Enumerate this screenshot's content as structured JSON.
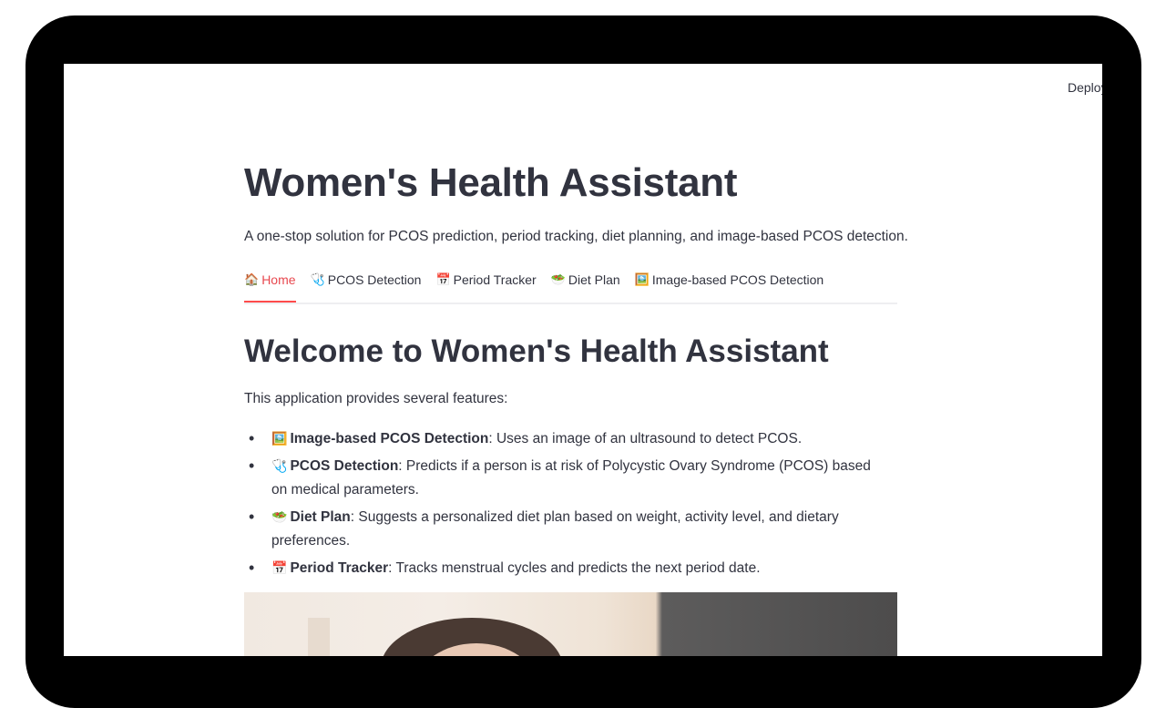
{
  "header": {
    "deploy_label": "Deploy"
  },
  "app": {
    "title": "Women's Health Assistant",
    "subtitle": "A one-stop solution for PCOS prediction, period tracking, diet planning, and image-based PCOS detection."
  },
  "tabs": [
    {
      "icon": "🏠",
      "icon_name": "house-icon",
      "label": "Home",
      "active": true
    },
    {
      "icon": "🩺",
      "icon_name": "stethoscope-icon",
      "label": "PCOS Detection",
      "active": false
    },
    {
      "icon": "📅",
      "icon_name": "calendar-icon",
      "label": "Period Tracker",
      "active": false
    },
    {
      "icon": "🥗",
      "icon_name": "salad-icon",
      "label": "Diet Plan",
      "active": false
    },
    {
      "icon": "🖼️",
      "icon_name": "picture-icon",
      "label": "Image-based PCOS Detection",
      "active": false
    }
  ],
  "home": {
    "heading": "Welcome to Women's Health Assistant",
    "intro": "This application provides several features:",
    "features": [
      {
        "icon": "🖼️",
        "icon_name": "picture-icon",
        "title": "Image-based PCOS Detection",
        "desc": ": Uses an image of an ultrasound to detect PCOS."
      },
      {
        "icon": "🩺",
        "icon_name": "stethoscope-icon",
        "title": "PCOS Detection",
        "desc": ": Predicts if a person is at risk of Polycystic Ovary Syndrome (PCOS) based on medical parameters."
      },
      {
        "icon": "🥗",
        "icon_name": "salad-icon",
        "title": "Diet Plan",
        "desc": ": Suggests a personalized diet plan based on weight, activity level, and dietary preferences."
      },
      {
        "icon": "📅",
        "icon_name": "calendar-icon",
        "title": "Period Tracker",
        "desc": ": Tracks menstrual cycles and predicts the next period date."
      }
    ]
  },
  "colors": {
    "accent": "#ff4b4b",
    "text": "#31333f",
    "frame": "#000000",
    "background": "#ffffff"
  }
}
